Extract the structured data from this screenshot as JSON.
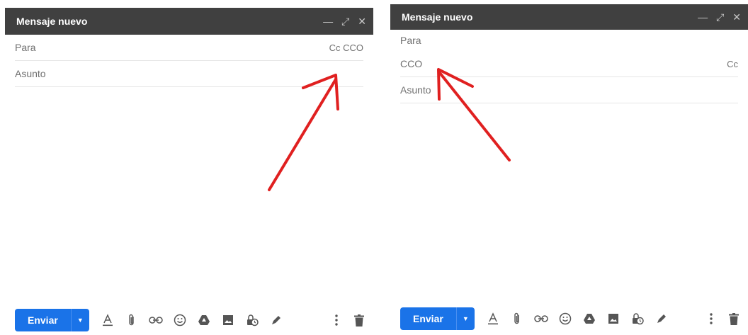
{
  "left_window": {
    "title": "Mensaje nuevo",
    "fields": {
      "to_label": "Para",
      "cc_bcc": "Cc CCO",
      "subject_label": "Asunto"
    },
    "send_label": "Enviar"
  },
  "right_window": {
    "title": "Mensaje nuevo",
    "fields": {
      "to_label": "Para",
      "bcc_label": "CCO",
      "cc_link": "Cc",
      "subject_label": "Asunto"
    },
    "send_label": "Enviar"
  },
  "icons": {
    "title": [
      "minimize-icon",
      "expand-icon",
      "close-icon"
    ],
    "toolbar": [
      "text-format-icon",
      "attach-icon",
      "link-icon",
      "emoji-icon",
      "drive-icon",
      "photo-icon",
      "confidential-icon",
      "signature-icon"
    ],
    "right": [
      "more-options-icon",
      "discard-icon"
    ]
  },
  "colors": {
    "titlebar": "#404040",
    "send": "#1a73e8",
    "arrow": "#e02020"
  }
}
